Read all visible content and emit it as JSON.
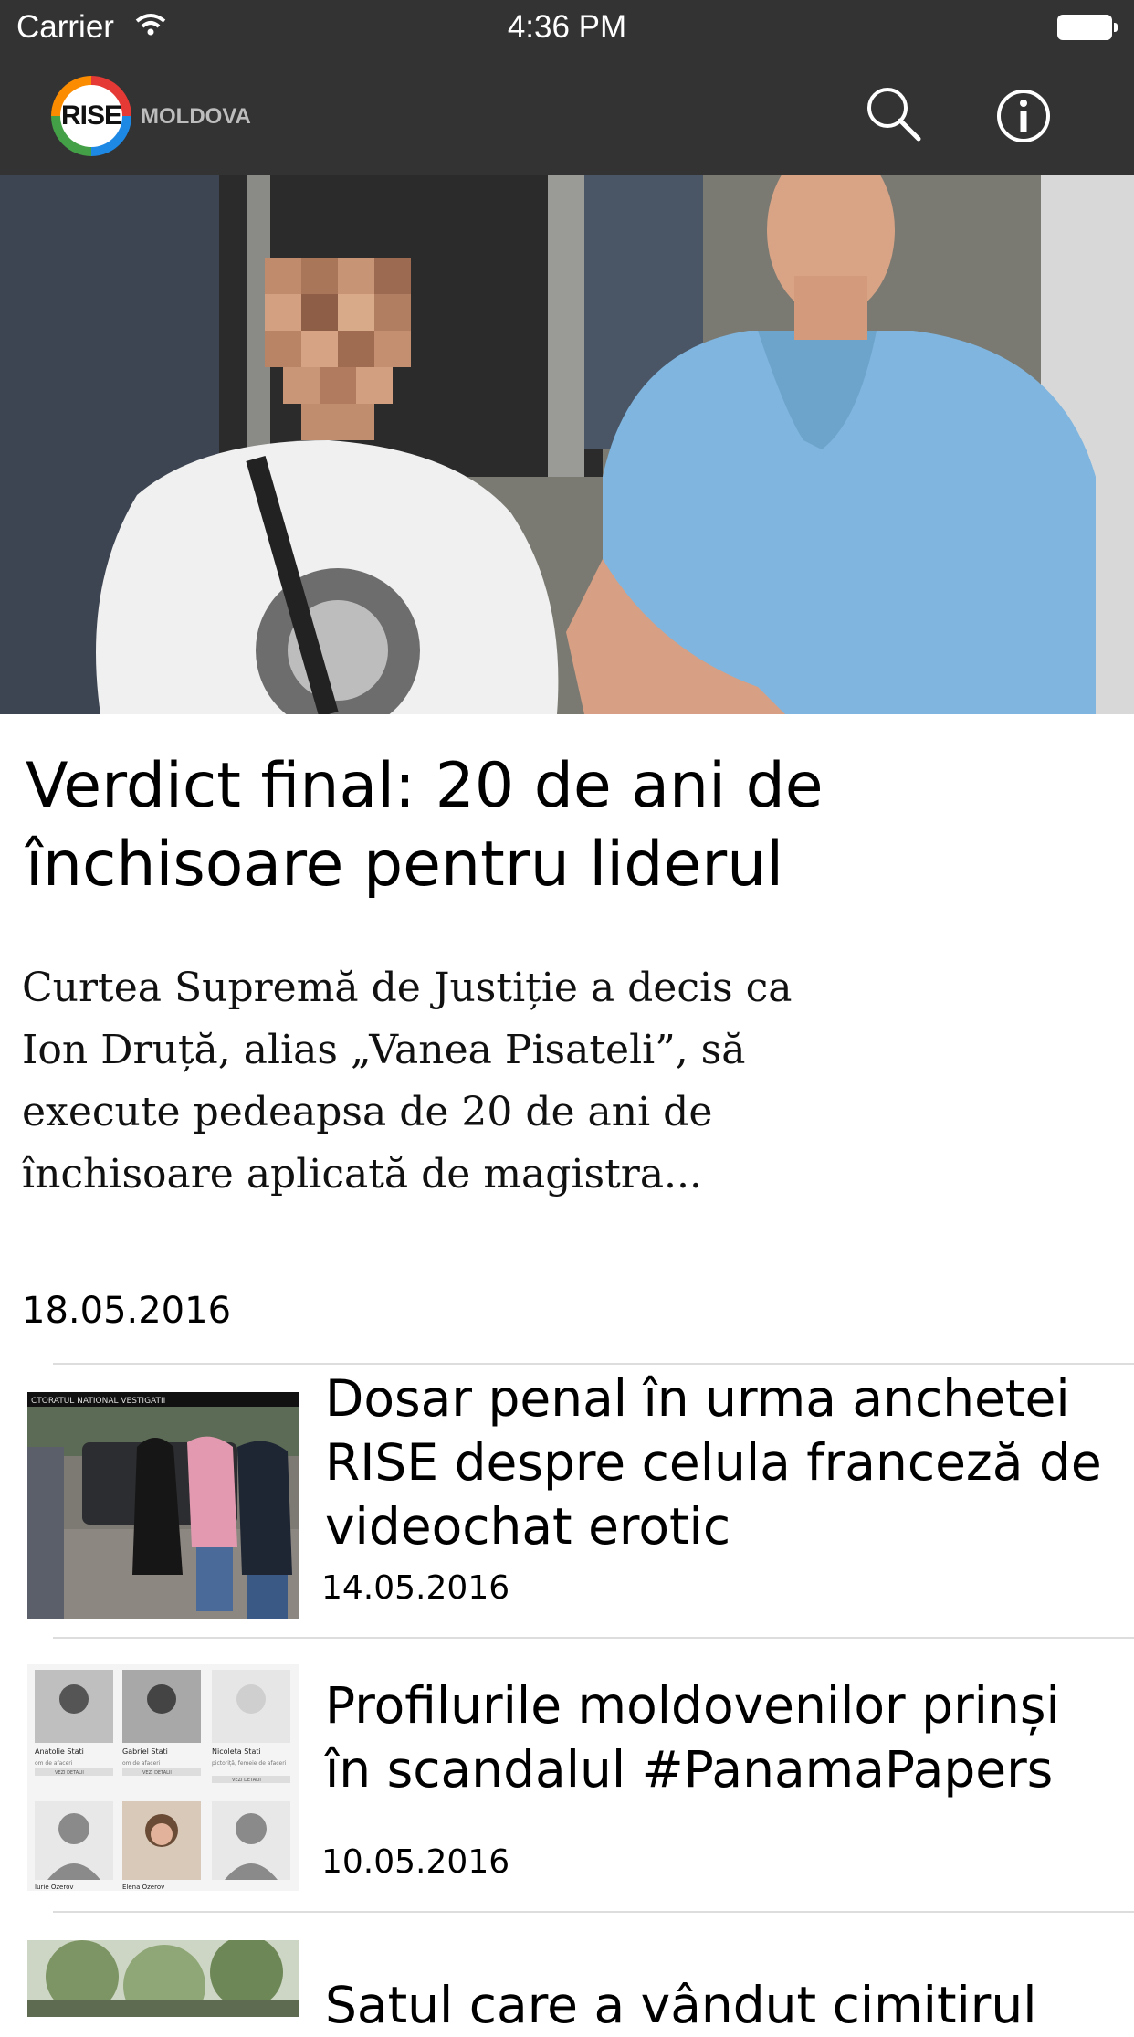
{
  "status_bar": {
    "carrier": "Carrier",
    "time": "4:36 PM"
  },
  "nav": {
    "logo_text": "RISE",
    "logo_subtitle": "MOLDOVA",
    "search_icon": "search-icon",
    "info_icon": "info-icon"
  },
  "featured": {
    "title": "Verdict final: 20 de ani de închisoare pentru liderul",
    "excerpt": "Curtea Supremă de Justiție a decis ca Ion Druță, alias „Vanea Pisateli”, să execute pedeapsa de 20 de ani de închisoare aplicată de magistra...",
    "date": "18.05.2016"
  },
  "articles": [
    {
      "title": "Dosar penal în urma anchetei RISE despre celula franceză de videochat erotic",
      "date": "14.05.2016"
    },
    {
      "title": "Profilurile moldovenilor prinși în scandalul #PanamaPapers",
      "date": "10.05.2016"
    },
    {
      "title": "Satul care a vândut cimitirul",
      "date": ""
    }
  ],
  "thumb_text": {
    "banner": "CTORATUL NATIONAL VESTIGATII",
    "people": [
      {
        "name": "Anatolie Stati",
        "role": "om de afaceri",
        "button": "VEZI DETALII"
      },
      {
        "name": "Gabriel Stati",
        "role": "om de afaceri",
        "button": "VEZI DETALII"
      },
      {
        "name": "Nicoleta Stati",
        "role": "pictoriță, femeie de afaceri",
        "button": "VEZI DETALII"
      },
      {
        "name": "Iurie Ozerov",
        "role": "",
        "button": ""
      },
      {
        "name": "Elena Ozerov",
        "role": "",
        "button": ""
      },
      {
        "name": "",
        "role": "",
        "button": ""
      }
    ]
  },
  "colors": {
    "bar_bg": "#333333",
    "text": "#000000",
    "divider": "#dddddd"
  }
}
